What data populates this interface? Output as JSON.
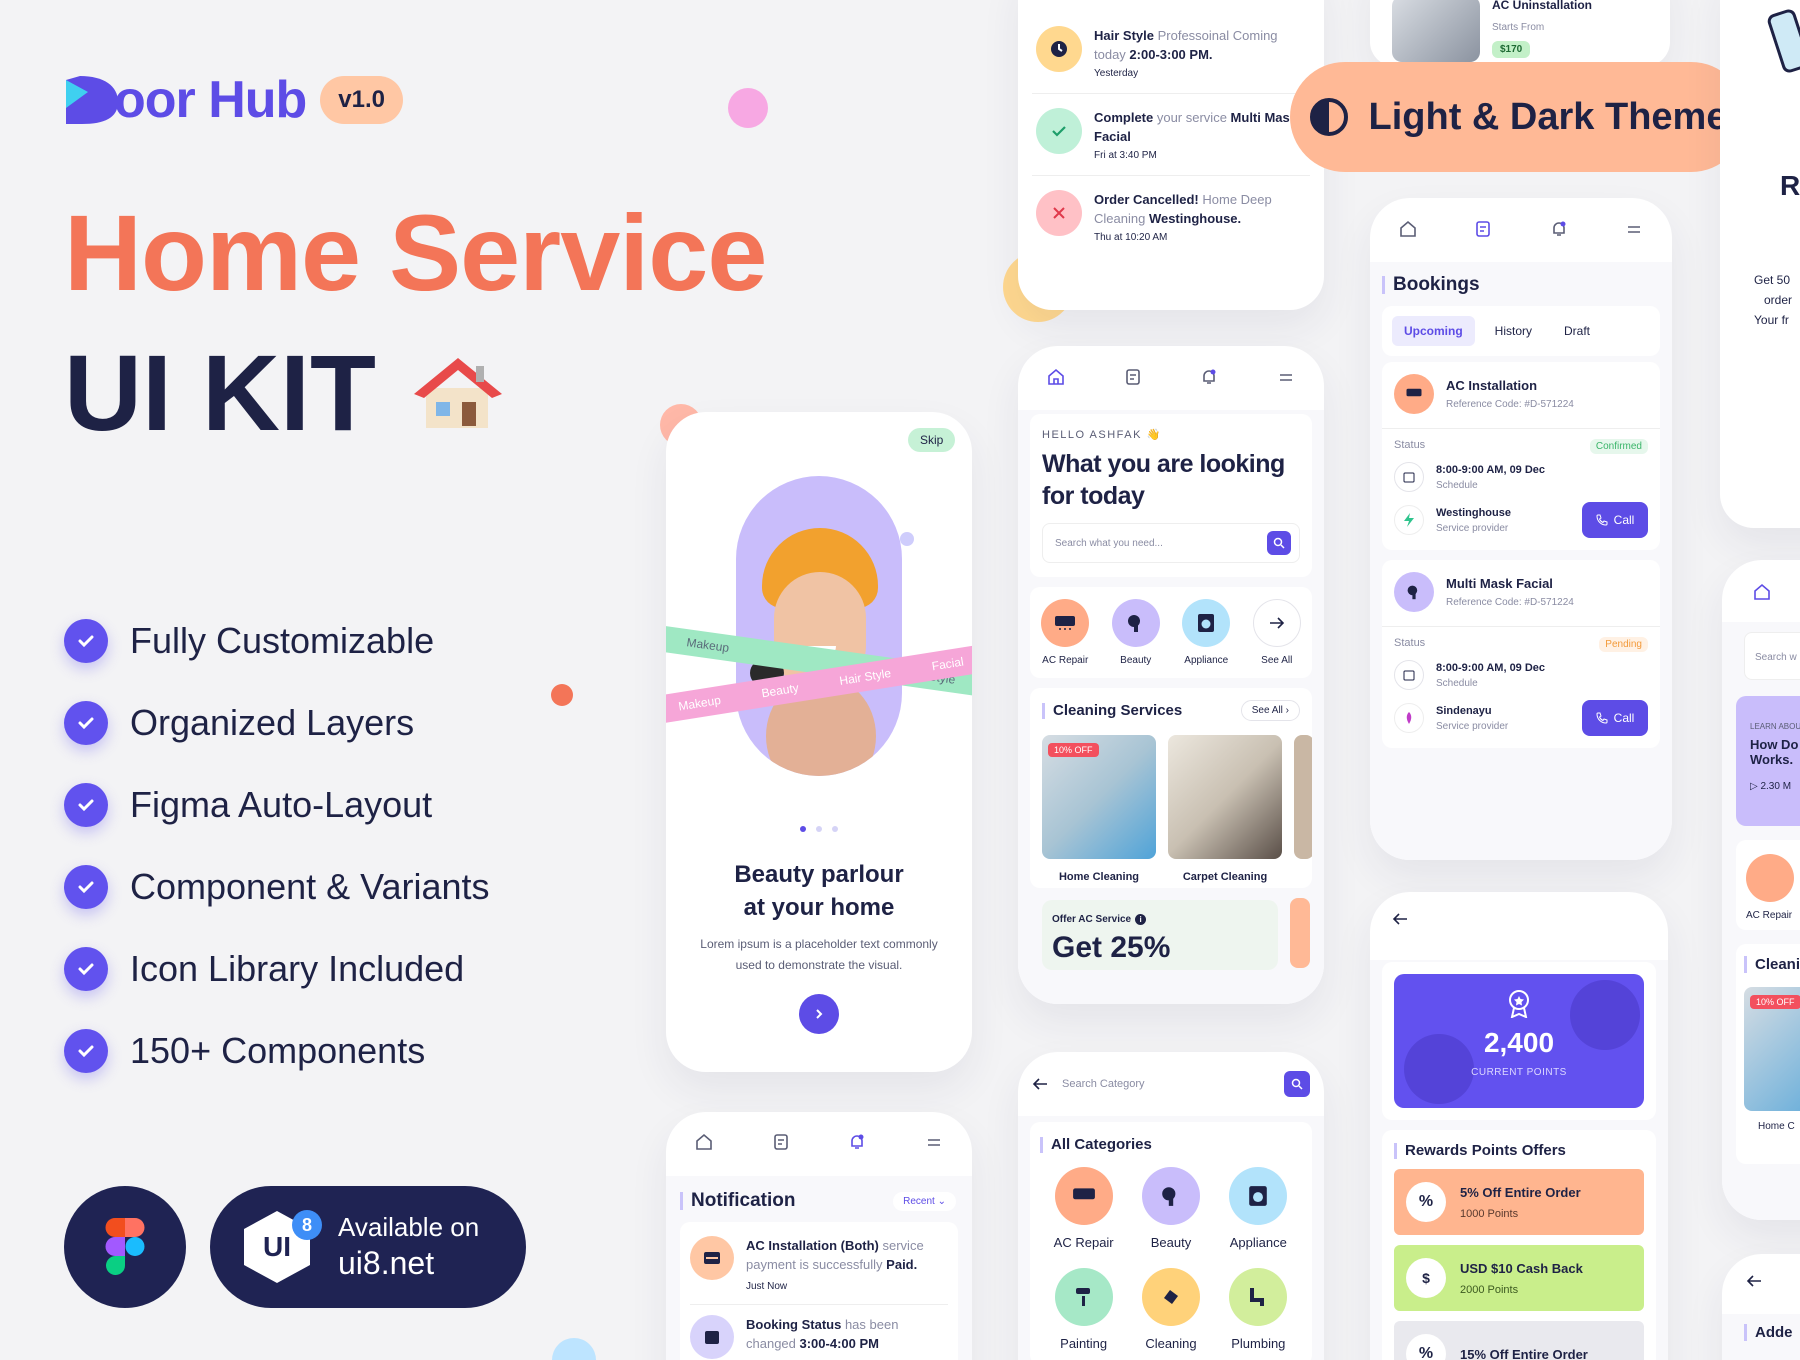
{
  "brand": {
    "name": "oor Hub",
    "version": "v1.0"
  },
  "headline": {
    "line1": "Home Service",
    "line2": "UI KIT"
  },
  "features": [
    "Fully Customizable",
    "Organized Layers",
    "Figma Auto-Layout",
    "Component & Variants",
    "Icon Library Included",
    "150+ Components"
  ],
  "badge": {
    "line1": "Available on",
    "line2": "ui8.net",
    "icon_text": "UI",
    "icon_num": "8"
  },
  "theme_pill": "Light & Dark Theme",
  "colors": {
    "primary": "#5d4ce6",
    "coral": "#f37558",
    "navy": "#1e2245",
    "peach": "#ffc7a4"
  },
  "top_notifications": [
    {
      "p1": "Hair Style",
      "p2": " Professoinal Coming today ",
      "p3": "2:00-3:00 PM.",
      "time": "Yesterday",
      "icon": "clock-icon"
    },
    {
      "p1": "Complete",
      "p2": " your service ",
      "p3": "Multi Mask Facial",
      "time": "Fri at 3:40 PM",
      "icon": "check-icon"
    },
    {
      "p1": "Order Cancelled!",
      "p2": " Home Deep Cleaning ",
      "p3": "Westinghouse.",
      "time": "Thu at 10:20 AM",
      "icon": "close-icon"
    }
  ],
  "ac_uninstall": {
    "title": "AC Uninstallation",
    "starts": "Starts From",
    "price": "$170"
  },
  "onboarding": {
    "skip": "Skip",
    "title1": "Beauty parlour",
    "title2": "at your home",
    "desc": "Lorem ipsum is a placeholder text commonly used to demonstrate the visual.",
    "ribbon1": [
      "Makeup",
      "Beauty",
      "Hair Style",
      "Facial"
    ],
    "ribbon2": [
      "Makeup",
      "Hair Style"
    ]
  },
  "home": {
    "greeting": "HELLO ASHFAK 👋",
    "title1": "What you are looking",
    "title2": "for today",
    "search_placeholder": "Search what you need...",
    "categories": [
      "AC Repair",
      "Beauty",
      "Appliance",
      "See All"
    ],
    "section": "Cleaning Services",
    "see_all": "See All",
    "discount": "10% OFF",
    "services": [
      "Home Cleaning",
      "Carpet Cleaning"
    ],
    "offer_label": "Offer AC Service",
    "offer_big": "Get 25%"
  },
  "bookings": {
    "title": "Bookings",
    "tabs": [
      "Upcoming",
      "History",
      "Draft"
    ],
    "items": [
      {
        "name": "AC Installation",
        "ref": "Reference Code: #D-571224",
        "status_label": "Status",
        "status": "Confirmed",
        "time": "8:00-9:00 AM,  09 Dec",
        "time_sub": "Schedule",
        "provider": "Westinghouse",
        "provider_sub": "Service provider",
        "call": "Call"
      },
      {
        "name": "Multi Mask Facial",
        "ref": "Reference Code: #D-571224",
        "status_label": "Status",
        "status": "Pending",
        "time": "8:00-9:00 AM,  09 Dec",
        "time_sub": "Schedule",
        "provider": "Sindenayu",
        "provider_sub": "Service provider",
        "call": "Call"
      }
    ]
  },
  "categories_screen": {
    "search_placeholder": "Search Category",
    "title": "All Categories",
    "items": [
      "AC Repair",
      "Beauty",
      "Appliance",
      "Painting",
      "Cleaning",
      "Plumbing"
    ]
  },
  "rewards": {
    "points": "2,400",
    "points_label": "CURRENT POINTS",
    "title": "Rewards Points Offers",
    "offers": [
      {
        "title": "5% Off Entire Order",
        "sub": "1000 Points",
        "icon": "%"
      },
      {
        "title": "USD $10 Cash Back",
        "sub": "2000 Points",
        "icon": "$"
      },
      {
        "title": "15% Off Entire Order",
        "sub": "",
        "icon": "%"
      }
    ]
  },
  "notification_screen": {
    "title": "Notification",
    "filter": "Recent",
    "items": [
      {
        "p1": "AC Installation (Both)",
        "p2": " service payment is successfully ",
        "p3": "Paid.",
        "time": "Just Now"
      },
      {
        "p1": "Booking Status",
        "p2": " has been changed ",
        "p3": "3:00-4:00 PM",
        "time": ""
      }
    ]
  },
  "right_partial": {
    "bullets": [
      "Get 50",
      "order",
      "Your fr"
    ],
    "heading": "R",
    "search": "Search w",
    "learn_label": "LEARN ABOU",
    "learn_title1": "How Do",
    "learn_title2": "Works.",
    "duration": "2.30 M",
    "cat": "AC Repair",
    "section": "Cleani",
    "discount": "10% OFF",
    "svc": "Home C",
    "added": "Adde"
  }
}
